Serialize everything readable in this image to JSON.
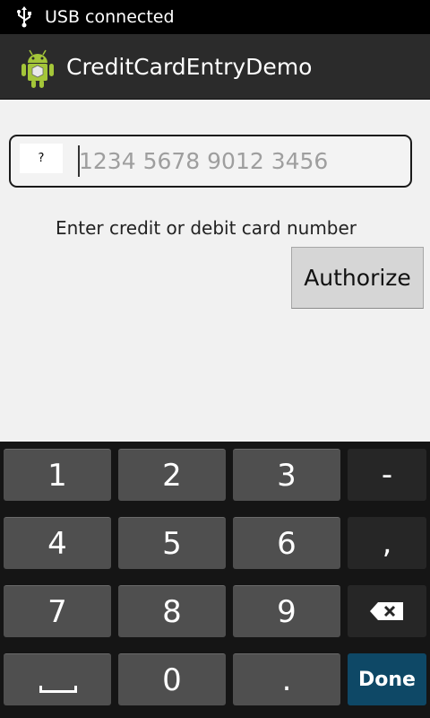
{
  "status_bar": {
    "text": "USB connected",
    "icon": "usb-icon"
  },
  "action_bar": {
    "title": "CreditCardEntryDemo",
    "icon": "android-icon"
  },
  "card_field": {
    "card_type": "?",
    "placeholder": "1234 5678 9012 3456",
    "value": ""
  },
  "hint": "Enter credit or debit card number",
  "authorize_label": "Authorize",
  "keyboard": {
    "rows": [
      [
        "1",
        "2",
        "3",
        "-"
      ],
      [
        "4",
        "5",
        "6",
        ","
      ],
      [
        "7",
        "8",
        "9",
        "backspace"
      ],
      [
        "space",
        "0",
        ".",
        "Done"
      ]
    ],
    "done_label": "Done",
    "comma": ",",
    "dash": "-",
    "dot": "."
  },
  "colors": {
    "done_key": "#0e4866",
    "number_key": "#4f4f4f",
    "keyboard_bg": "#151515"
  }
}
